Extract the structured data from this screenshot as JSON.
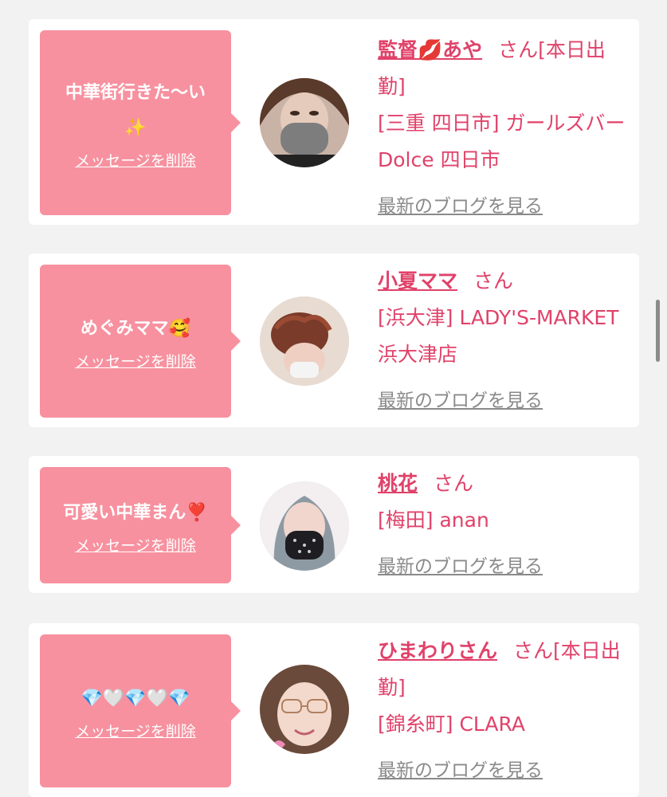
{
  "cards": [
    {
      "message_text": "中華街行きた〜い",
      "message_emoji": "✨",
      "delete_label": "メッセージを削除",
      "name": "監督💋あや",
      "honorific": "さん[本日出勤]",
      "shop": "[三重 四日市] ガールズバー Dolce 四日市",
      "blog_label": "最新のブログを見る"
    },
    {
      "message_text": "めぐみママ🥰",
      "delete_label": "メッセージを削除",
      "name": "小夏ママ",
      "honorific": "さん",
      "shop": "[浜大津] LADY'S-MARKET 浜大津店",
      "blog_label": "最新のブログを見る"
    },
    {
      "message_text": "可愛い中華まん❣️",
      "delete_label": "メッセージを削除",
      "name": "桃花",
      "honorific": "さん",
      "shop": "[梅田] anan",
      "blog_label": "最新のブログを見る"
    },
    {
      "message_text": "💎🤍💎🤍💎",
      "delete_label": "メッセージを削除",
      "name": "ひまわりさん",
      "honorific": "さん[本日出勤]",
      "shop": "[錦糸町] CLARA",
      "blog_label": "最新のブログを見る"
    }
  ],
  "colors": {
    "bubble": "#f7919f",
    "accent": "#e0426a",
    "link_gray": "#8a8a8a",
    "background": "#f2f2f2"
  }
}
